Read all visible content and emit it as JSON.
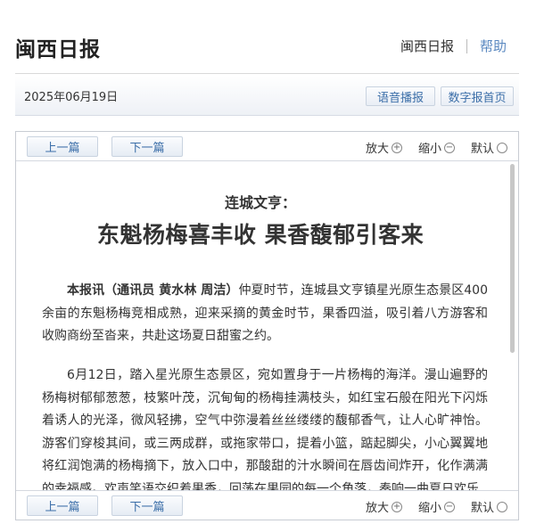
{
  "header": {
    "site_title": "闽西日报",
    "link_main": "闽西日报",
    "link_help": "帮助"
  },
  "datebar": {
    "date": "2025年06月19日",
    "audio_btn": "语音播报",
    "home_btn": "数字报首页"
  },
  "nav": {
    "prev": "上一篇",
    "next": "下一篇",
    "zoom_in": "放大",
    "zoom_out": "缩小",
    "default": "默认"
  },
  "icons": {
    "zoom_in": "plus-circle-icon",
    "zoom_out": "minus-circle-icon",
    "default": "circle-icon"
  },
  "article": {
    "kicker": "连城文亨：",
    "headline": "东魁杨梅喜丰收 果香馥郁引客来",
    "byline": "本报讯（通讯员 黄水林 周洁）",
    "para1_rest": "仲夏时节，连城县文亨镇星光原生态景区400余亩的东魁杨梅竞相成熟，迎来采摘的黄金时节，果香四溢，吸引着八方游客和收购商纷至沓来，共赴这场夏日甜蜜之约。",
    "para2": "6月12日，踏入星光原生态景区，宛如置身于一片杨梅的海洋。漫山遍野的杨梅树郁郁葱葱，枝繁叶茂，沉甸甸的杨梅挂满枝头，如红宝石般在阳光下闪烁着诱人的光泽，微风轻拂，空气中弥漫着丝丝缕缕的馥郁香气，让人心旷神怡。游客们穿梭其间，或三两成群，或拖家带口，提着小篮，踮起脚尖，小心翼翼地将红润饱满的杨梅摘下，放入口中，那酸甜的汁水瞬间在唇齿间炸开，化作满满的幸福感。欢声笑语交织着果香，回荡在果园的每一个角落，奏响一曲夏日欢乐"
  }
}
